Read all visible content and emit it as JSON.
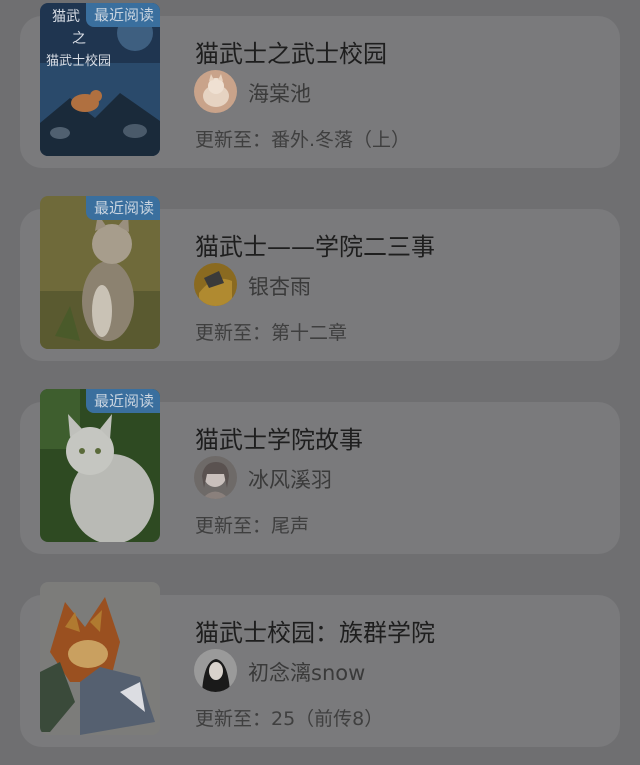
{
  "books": [
    {
      "badge": "最近阅读",
      "title": "猫武士之武士校园",
      "author": "海棠池",
      "update": "更新至：番外.冬落（上）",
      "cover_text": [
        "猫武",
        "之",
        "猫武士校园"
      ]
    },
    {
      "badge": "最近阅读",
      "title": "猫武士——学院二三事",
      "author": "银杏雨",
      "update": "更新至：第十二章"
    },
    {
      "badge": "最近阅读",
      "title": "猫武士学院故事",
      "author": "冰风溪羽",
      "update": "更新至：尾声"
    },
    {
      "title": "猫武士校园：族群学院",
      "author": "初念漓snow",
      "update": "更新至：25（前传8）"
    }
  ],
  "colors": {
    "background": "#6f6f71",
    "card": "#7a7a7c",
    "badge": "#3a6f9e"
  }
}
